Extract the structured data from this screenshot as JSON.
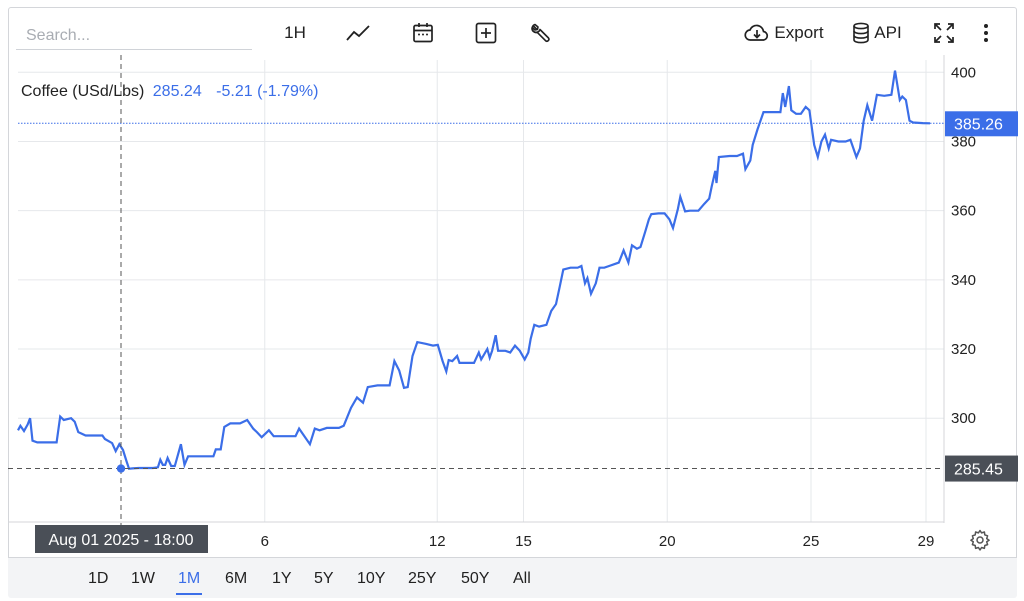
{
  "toolbar": {
    "search_placeholder": "Search...",
    "interval_label": "1H",
    "export_label": "Export",
    "api_label": "API",
    "icons": [
      "line-chart-icon",
      "calendar-icon",
      "add-compare-icon",
      "wrench-icon",
      "cloud-download-icon",
      "database-icon",
      "fullscreen-icon",
      "more-vertical-icon"
    ]
  },
  "legend": {
    "name": "Coffee (USd/Lbs)",
    "value": "285.24",
    "change": "-5.21 (-1.79%)"
  },
  "crosshair": {
    "date_label": "Aug 01 2025 - 18:00",
    "price_label": "285.45",
    "price": 285.45,
    "date_day": 1
  },
  "last_price": {
    "label": "385.26",
    "value": 385.26
  },
  "ranges": [
    {
      "label": "1D",
      "active": false
    },
    {
      "label": "1W",
      "active": false
    },
    {
      "label": "1M",
      "active": true
    },
    {
      "label": "6M",
      "active": false
    },
    {
      "label": "1Y",
      "active": false
    },
    {
      "label": "5Y",
      "active": false
    },
    {
      "label": "10Y",
      "active": false
    },
    {
      "label": "25Y",
      "active": false
    },
    {
      "label": "50Y",
      "active": false
    },
    {
      "label": "All",
      "active": false
    }
  ],
  "colors": {
    "line": "#3b6ee8",
    "grid": "#e6e8eb",
    "crosshair": "#555555",
    "label_bg": "#4a4f57"
  },
  "chart_data": {
    "type": "line",
    "title": "",
    "xlabel": "",
    "ylabel": "",
    "x_unit": "day of August 2025",
    "ylim": [
      270,
      405
    ],
    "xlim": [
      0.0,
      29.4
    ],
    "yticks": [
      "300",
      "320",
      "340",
      "360",
      "380",
      "400"
    ],
    "xticks": [
      {
        "label": "6",
        "value": 6
      },
      {
        "label": "12",
        "value": 12
      },
      {
        "label": "15",
        "value": 15
      },
      {
        "label": "20",
        "value": 20
      },
      {
        "label": "25",
        "value": 25
      },
      {
        "label": "29",
        "value": 29
      }
    ],
    "grid": true,
    "series": [
      {
        "values": [
          [
            0.0,
            296.5
          ],
          [
            0.1,
            297.8
          ],
          [
            0.25,
            296.3
          ],
          [
            0.4,
            298.2
          ],
          [
            0.5,
            300
          ],
          [
            0.6,
            293.5
          ],
          [
            0.8,
            293
          ],
          [
            1.2,
            293
          ],
          [
            1.6,
            293
          ],
          [
            1.75,
            300.5
          ],
          [
            1.9,
            299.5
          ],
          [
            2.2,
            300
          ],
          [
            2.35,
            299
          ],
          [
            2.5,
            296
          ],
          [
            2.8,
            295
          ],
          [
            3.2,
            295
          ],
          [
            3.5,
            295
          ],
          [
            3.6,
            294
          ],
          [
            3.9,
            292.8
          ],
          [
            4.05,
            290.5
          ],
          [
            4.2,
            292.5
          ],
          [
            4.35,
            290.8
          ],
          [
            4.5,
            287.5
          ],
          [
            4.6,
            285.4
          ],
          [
            4.75,
            285.5
          ],
          [
            5.0,
            285.6
          ],
          [
            5.2,
            285.6
          ],
          [
            5.4,
            285.6
          ],
          [
            5.6,
            285.6
          ],
          [
            5.8,
            285.8
          ],
          [
            5.9,
            288
          ],
          [
            6.0,
            286.5
          ],
          [
            6.1,
            286.5
          ],
          [
            6.2,
            288.5
          ],
          [
            6.35,
            286.2
          ],
          [
            6.5,
            286.2
          ],
          [
            6.75,
            292.5
          ],
          [
            6.9,
            286.5
          ],
          [
            7.05,
            289
          ],
          [
            7.2,
            289
          ],
          [
            7.6,
            289
          ],
          [
            8.1,
            289
          ],
          [
            8.2,
            291
          ],
          [
            8.4,
            291
          ],
          [
            8.55,
            297.5
          ],
          [
            8.8,
            298.5
          ],
          [
            9.2,
            298.5
          ],
          [
            9.5,
            299.5
          ],
          [
            9.75,
            297
          ],
          [
            9.9,
            296
          ],
          [
            10.1,
            294.5
          ],
          [
            10.4,
            296.5
          ],
          [
            10.6,
            294.8
          ],
          [
            11.2,
            294.8
          ],
          [
            11.5,
            294.8
          ],
          [
            11.65,
            297
          ],
          [
            12.1,
            292.5
          ],
          [
            12.3,
            297
          ],
          [
            12.5,
            296.5
          ],
          [
            12.8,
            297.2
          ],
          [
            13.3,
            297.2
          ],
          [
            13.5,
            297.8
          ],
          [
            13.8,
            303
          ],
          [
            14.05,
            306
          ],
          [
            14.3,
            304.5
          ],
          [
            14.5,
            309
          ],
          [
            14.9,
            309.5
          ],
          [
            15.2,
            309.5
          ],
          [
            15.4,
            309.5
          ],
          [
            15.6,
            316.5
          ],
          [
            15.8,
            313.8
          ],
          [
            16.0,
            308.8
          ],
          [
            16.15,
            309
          ],
          [
            16.35,
            318
          ],
          [
            16.55,
            322
          ],
          [
            16.9,
            321.5
          ],
          [
            17.2,
            321
          ],
          [
            17.4,
            321.2
          ],
          [
            17.6,
            316.5
          ],
          [
            17.75,
            313.5
          ],
          [
            17.85,
            316.8
          ],
          [
            18.0,
            316.5
          ],
          [
            18.2,
            318
          ],
          [
            18.3,
            316
          ],
          [
            18.5,
            316
          ],
          [
            18.9,
            316
          ],
          [
            19.1,
            319
          ],
          [
            19.2,
            317
          ],
          [
            19.45,
            320
          ],
          [
            19.55,
            317.5
          ],
          [
            19.65,
            319.5
          ],
          [
            19.8,
            324
          ],
          [
            19.9,
            319.5
          ],
          [
            20.2,
            319.5
          ],
          [
            20.4,
            319
          ],
          [
            20.6,
            321
          ],
          [
            20.8,
            319.5
          ],
          [
            21.0,
            317
          ],
          [
            21.15,
            319
          ],
          [
            21.25,
            323
          ],
          [
            21.4,
            327
          ],
          [
            21.6,
            326.5
          ],
          [
            21.9,
            327
          ],
          [
            22.1,
            331
          ],
          [
            22.3,
            333
          ],
          [
            22.45,
            338
          ],
          [
            22.6,
            343
          ],
          [
            22.9,
            343.5
          ],
          [
            23.2,
            343.5
          ],
          [
            23.35,
            344
          ],
          [
            23.5,
            339
          ],
          [
            23.6,
            340.5
          ],
          [
            23.75,
            336
          ],
          [
            23.95,
            339
          ],
          [
            24.1,
            343.5
          ],
          [
            24.3,
            343.5
          ],
          [
            24.5,
            344
          ],
          [
            24.7,
            344.5
          ],
          [
            24.9,
            345
          ],
          [
            25.1,
            348.5
          ],
          [
            25.3,
            345
          ],
          [
            25.45,
            350
          ],
          [
            25.65,
            349
          ],
          [
            25.8,
            349.5
          ],
          [
            26.0,
            354
          ],
          [
            26.15,
            357.5
          ],
          [
            26.25,
            359
          ],
          [
            26.55,
            359.2
          ],
          [
            26.8,
            359.2
          ],
          [
            27.0,
            357.5
          ],
          [
            27.15,
            355
          ],
          [
            27.35,
            360.5
          ],
          [
            27.45,
            364
          ],
          [
            27.65,
            359.8
          ],
          [
            27.85,
            360
          ],
          [
            28.2,
            360
          ],
          [
            28.45,
            362
          ],
          [
            28.65,
            363.5
          ],
          [
            28.75,
            367
          ],
          [
            28.9,
            371.5
          ],
          [
            28.95,
            368
          ],
          [
            29.05,
            375.5
          ],
          [
            29.5,
            375.8
          ],
          [
            29.8,
            375.8
          ],
          [
            30.05,
            376.5
          ],
          [
            30.15,
            372
          ],
          [
            30.35,
            374.5
          ],
          [
            30.45,
            379
          ],
          [
            30.65,
            383.5
          ],
          [
            30.9,
            388.5
          ],
          [
            31.1,
            388.5
          ],
          [
            31.4,
            388.5
          ],
          [
            31.6,
            388.5
          ],
          [
            31.7,
            394
          ],
          [
            31.8,
            390
          ],
          [
            31.95,
            396
          ],
          [
            32.05,
            389
          ],
          [
            32.25,
            388
          ],
          [
            32.45,
            388
          ],
          [
            32.65,
            390
          ],
          [
            32.8,
            389
          ],
          [
            33.0,
            379
          ],
          [
            33.15,
            375.5
          ],
          [
            33.3,
            380
          ],
          [
            33.45,
            382
          ],
          [
            33.6,
            378
          ],
          [
            33.7,
            380.5
          ],
          [
            34.0,
            380
          ],
          [
            34.3,
            380
          ],
          [
            34.5,
            380.5
          ],
          [
            34.75,
            375.5
          ],
          [
            34.9,
            378
          ],
          [
            35.05,
            386
          ],
          [
            35.2,
            390.5
          ],
          [
            35.4,
            386
          ],
          [
            35.6,
            393.5
          ],
          [
            35.9,
            393.2
          ],
          [
            36.2,
            393.5
          ],
          [
            36.35,
            400.5
          ],
          [
            36.55,
            392
          ],
          [
            36.65,
            393
          ],
          [
            36.8,
            392
          ],
          [
            36.95,
            386
          ],
          [
            37.1,
            385.5
          ],
          [
            37.5,
            385.3
          ],
          [
            37.8,
            385.26
          ]
        ]
      }
    ]
  }
}
